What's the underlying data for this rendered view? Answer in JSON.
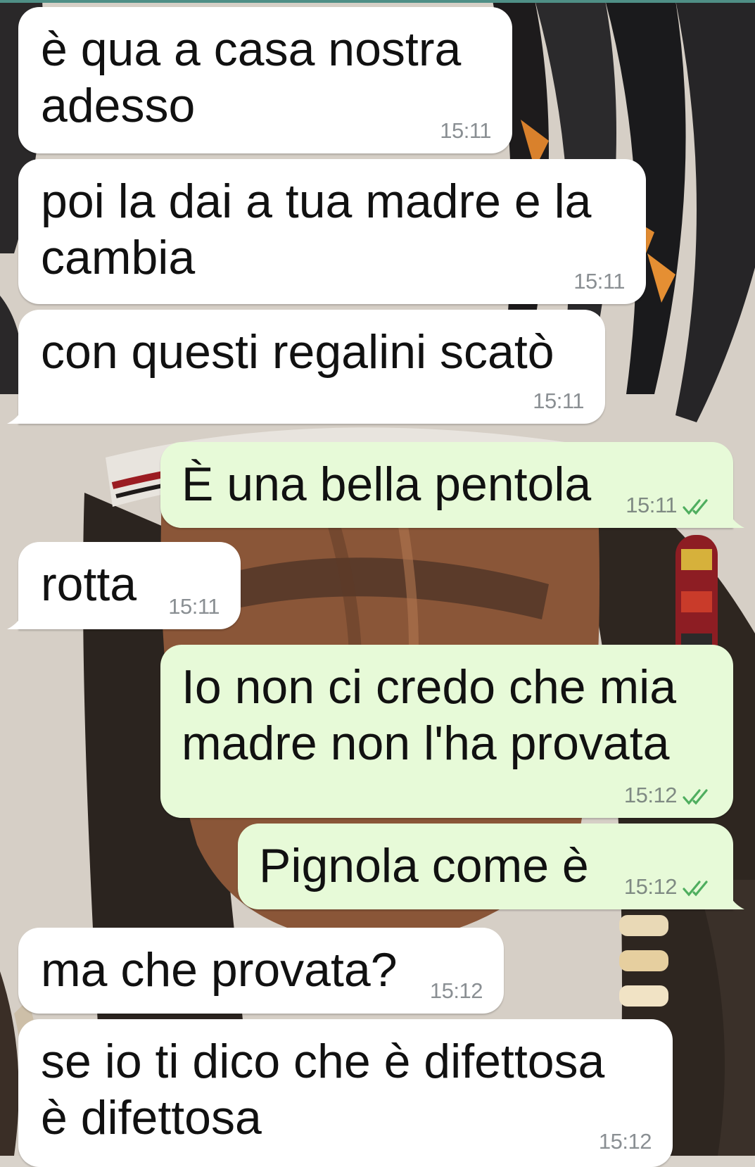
{
  "colors": {
    "incoming_bubble": "#ffffff",
    "outgoing_bubble": "#e7fad8",
    "read_check": "#4fae5f",
    "timestamp": "#8a8f93"
  },
  "icons": {
    "read_receipt": "double-check-icon"
  },
  "messages": [
    {
      "direction": "incoming",
      "text": "è qua a casa nostra\nadesso",
      "time": "15:11"
    },
    {
      "direction": "incoming",
      "text": "poi la dai a tua madre e la\ncambia",
      "time": "15:11"
    },
    {
      "direction": "incoming",
      "text": "con questi regalini scatò",
      "time": "15:11"
    },
    {
      "direction": "outgoing",
      "text": "È una bella pentola",
      "time": "15:11",
      "status": "read"
    },
    {
      "direction": "incoming",
      "text": "rotta",
      "time": "15:11"
    },
    {
      "direction": "outgoing",
      "text": "Io non ci credo che mia\nmadre non l'ha provata",
      "time": "15:12",
      "status": "read"
    },
    {
      "direction": "outgoing",
      "text": "Pignola come è",
      "time": "15:12",
      "status": "read"
    },
    {
      "direction": "incoming",
      "text": "ma che provata?",
      "time": "15:12"
    },
    {
      "direction": "incoming",
      "text": "se io ti dico che è difettosa\nè difettosa",
      "time": "15:12"
    }
  ]
}
